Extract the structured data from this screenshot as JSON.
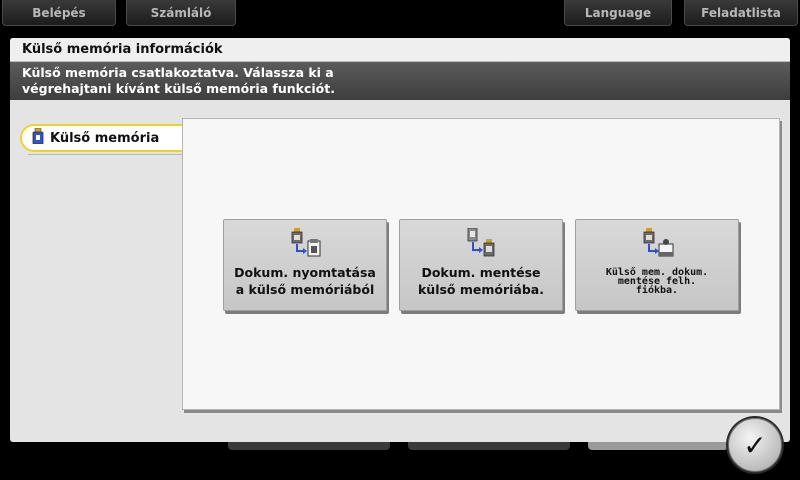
{
  "topbar": {
    "login_label": "Belépés",
    "counter_label": "Számláló",
    "language_label": "Language",
    "joblist_label": "Feladatlista"
  },
  "dialog": {
    "title": "Külső memória információk",
    "message_line1": "Külső memória csatlakoztatva. Válassza ki a",
    "message_line2": "végrehajtani kívánt külső memória funkciót."
  },
  "side_tab": {
    "label": "Külső memória",
    "icon": "usb-memory-icon"
  },
  "functions": [
    {
      "line1": "Dokum. nyomtatása",
      "line2": "a külső memóriából",
      "icon": "print-from-usb-icon"
    },
    {
      "line1": "Dokum. mentése",
      "line2": "külső memóriába.",
      "icon": "save-to-usb-icon"
    },
    {
      "line1": "Külső mem. dokum.",
      "line2": "mentése felh.",
      "line3": "fiókba.",
      "icon": "usb-to-user-box-icon"
    }
  ],
  "ok_button": {
    "icon": "checkmark-icon",
    "glyph": "✓"
  },
  "colors": {
    "accent_yellow": "#f2d12b",
    "message_bar": "#4a4a4a",
    "panel_bg": "#f7f7f7"
  }
}
